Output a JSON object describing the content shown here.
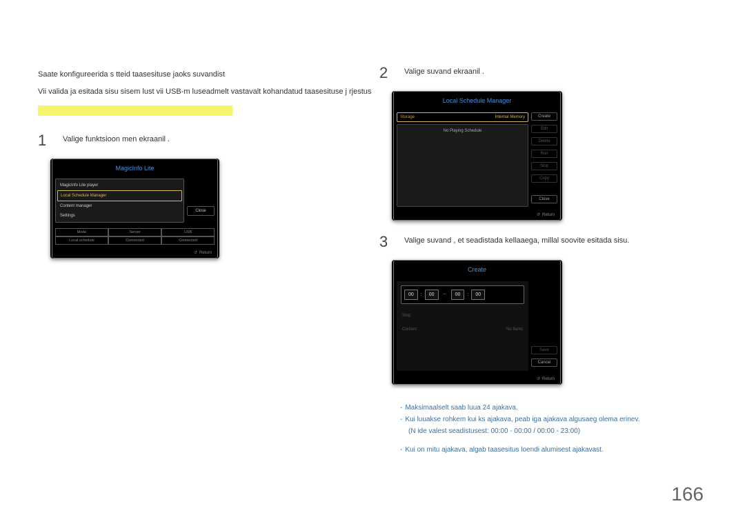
{
  "intro1": "Saate konfigureerida s tteid taasesituse jaoks suvandist",
  "intro2": "Vii valida ja esitada sisu sisem lust vii USB-m luseadmelt vastavalt kohandatud taasesituse j rjestus",
  "step1": {
    "num": "1",
    "text": "Valige funktsioon  men  ekraanil ."
  },
  "step2": {
    "num": "2",
    "text": "Valige suvand          ekraanil ."
  },
  "step3": {
    "num": "3",
    "text": "Valige suvand , et seadistada kellaaega, millal soovite esitada sisu."
  },
  "mlite": {
    "title": "MagicInfo Lite",
    "items": [
      "MagicInfo Lite player",
      "Local Schedule Manager",
      "Content manager",
      "Settings"
    ],
    "close": "Close",
    "table_h": [
      "Mode",
      "Server",
      "USB"
    ],
    "table_v": [
      "Local schedule",
      "Connected",
      "Connected"
    ],
    "return": "Return"
  },
  "lsm": {
    "title": "Local Schedule Manager",
    "storage_l": "Storage",
    "storage_r": "Internal Memory",
    "noplay": "No Playing Schedule",
    "btns": [
      "Create",
      "Edit",
      "Delete",
      "Run",
      "Stop",
      "Copy"
    ],
    "close": "Close",
    "return": "Return"
  },
  "crt": {
    "title": "Create",
    "t": [
      "00",
      "00",
      "00",
      "00"
    ],
    "row1_l": "Step",
    "row1_r": "",
    "row2_l": "Content",
    "row2_r": "No Items",
    "save": "Save",
    "cancel": "Cancel",
    "return": "Return"
  },
  "notes": {
    "n1": "Maksimaalselt saab luua 24 ajakava.",
    "n2": "Kui luuakse rohkem kui  ks ajakava, peab iga ajakava algusaeg olema erinev.",
    "n2b": "(N ide valest seadistusest: 00:00 - 00:00 / 00:00 - 23:00)",
    "n3": "Kui on mitu ajakava, algab taasesitus loendi alumisest ajakavast."
  },
  "pagenum": "166"
}
